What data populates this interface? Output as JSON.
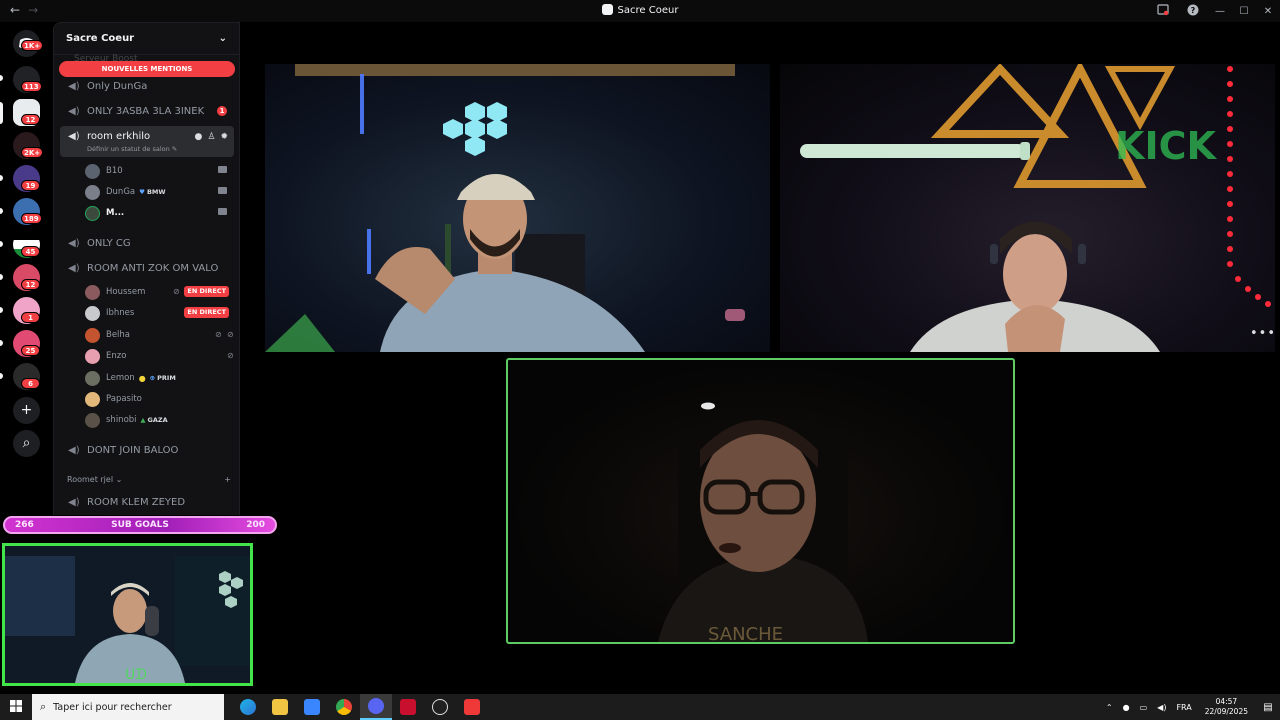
{
  "window": {
    "title": "Sacre Coeur",
    "nav_back": "←",
    "nav_forward": "→",
    "controls": {
      "minimize": "—",
      "maximize": "☐",
      "close": "✕"
    }
  },
  "rail": {
    "badges": [
      "1K+",
      "113",
      "12",
      "2K+",
      "19",
      "189",
      "45",
      "12",
      "1",
      "25",
      "6"
    ],
    "add_label": "+",
    "explore_label": "⌕"
  },
  "server": {
    "name": "Sacre Coeur",
    "chevron": "⌄",
    "mentions_banner": "NOUVELLES MENTIONS",
    "ghost_channel": "Serveur Boost"
  },
  "channels": [
    {
      "name": "Only DunGa"
    },
    {
      "name": "ONLY 3ASBA 3LA 3INEK",
      "unread": "1"
    },
    {
      "name": "room erkhilo",
      "status": "Définir un statut de salon ✎"
    }
  ],
  "erkhilo_members": [
    {
      "name": "B10"
    },
    {
      "name": "DunGa",
      "tag": "BMW",
      "tag_icon": "♥"
    },
    {
      "name": "M..."
    }
  ],
  "channel_only_cg": "ONLY CG",
  "channel_anti_zok": "ROOM ANTI ZOK OM VALO",
  "anti_zok_members": [
    {
      "name": "Houssem",
      "badge": "EN DIRECT"
    },
    {
      "name": "Ibhnes",
      "badge": "EN DIRECT"
    },
    {
      "name": "Belha"
    },
    {
      "name": "Enzo"
    },
    {
      "name": "Lemon",
      "tag": "PRIM",
      "tag_icon": "⊕"
    },
    {
      "name": "Papasito"
    },
    {
      "name": "shinobi",
      "tag": "GAZA",
      "tag_icon": "▲"
    }
  ],
  "channel_dont_join": "DONT JOIN BALOO",
  "category": {
    "name": "Roomet rjel ⌄",
    "add": "+"
  },
  "channel_klem": "ROOM KLEM ZEYED",
  "subgoals": {
    "current": "266",
    "label": "SUB GOALS",
    "target": "200"
  },
  "stage": {
    "more_label": "•••"
  },
  "taskbar": {
    "search_placeholder": "Taper ici pour rechercher",
    "language": "FRA",
    "time": "04:57",
    "date": "22/09/2025"
  }
}
